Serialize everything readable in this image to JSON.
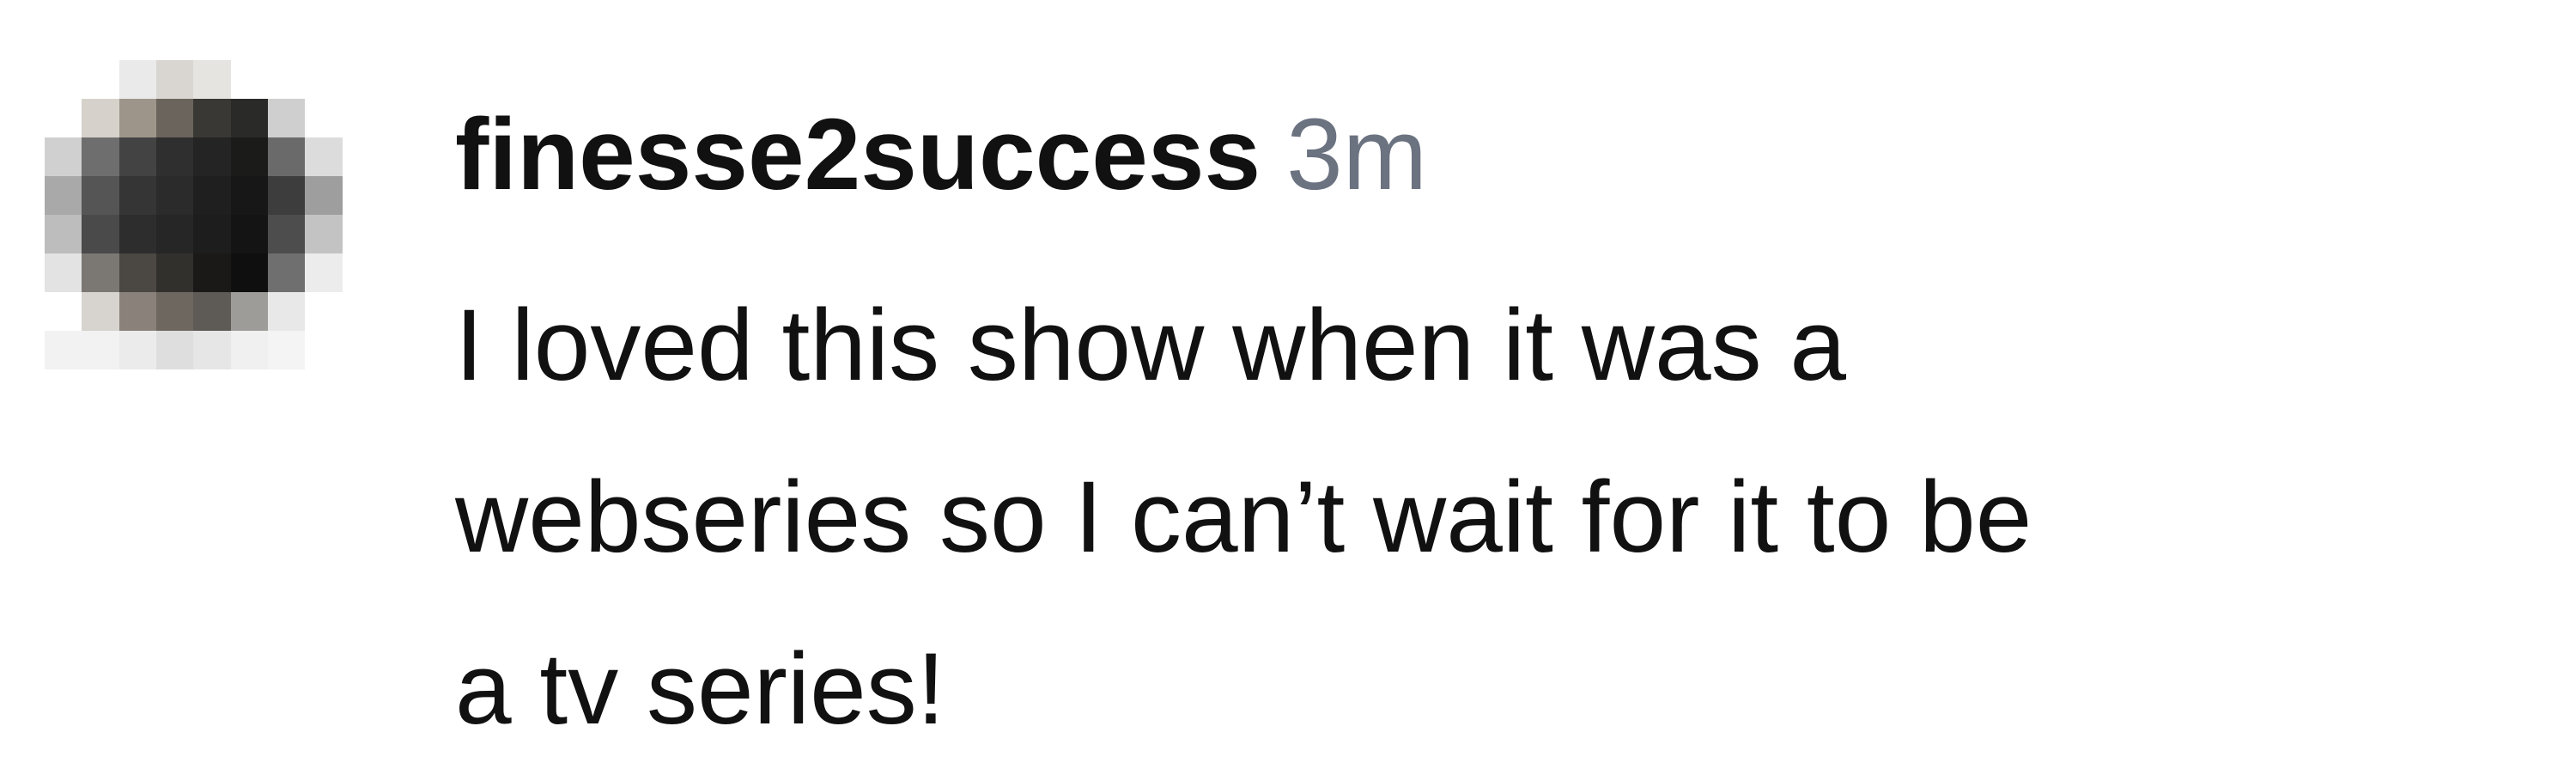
{
  "comment": {
    "username": "finesse2success",
    "timestamp": "3m",
    "text_lines": [
      "I loved this show when it was a",
      "webseries so I can’t wait for it to be",
      "a tv series!"
    ],
    "avatar": {
      "style": "pixelated",
      "colors": [
        "#ffffff",
        "#ffffff",
        "#eaeaea",
        "#d9d6d1",
        "#e6e4e1",
        "#ffffff",
        "#ffffff",
        "#ffffff",
        "#ffffff",
        "#ffffff",
        "#d6d2cb",
        "#9e958a",
        "#6a645c",
        "#3a3835",
        "#2a2a28",
        "#cfcfcf",
        "#ffffff",
        "#ffffff",
        "#d0d0d0",
        "#6e6e6e",
        "#434343",
        "#2f2f2f",
        "#242424",
        "#1b1b1a",
        "#6a6a6a",
        "#dcdcdc",
        "#ffffff",
        "#a9a9a9",
        "#555555",
        "#353535",
        "#2b2b2b",
        "#1f1f1f",
        "#171717",
        "#3d3d3d",
        "#9e9e9e",
        "#ffffff",
        "#bdbdbd",
        "#4a4a4a",
        "#2d2d2d",
        "#262626",
        "#1d1d1d",
        "#141414",
        "#4d4d4d",
        "#c3c3c3",
        "#ffffff",
        "#e3e3e3",
        "#7b7874",
        "#4b4742",
        "#32302d",
        "#1a1918",
        "#0f0f0f",
        "#6f6f6f",
        "#ececec",
        "#ffffff",
        "#ffffff",
        "#d7d4cf",
        "#8a827a",
        "#6e6760",
        "#5e5a55",
        "#9e9c99",
        "#e8e8e8",
        "#ffffff",
        "#ffffff",
        "#f2f2f2",
        "#f2f2f2",
        "#ebebeb",
        "#dedede",
        "#e6e6e6",
        "#f0f0f0",
        "#f4f4f4",
        "#ffffff",
        "#ffffff",
        "#ffffff",
        "#ffffff",
        "#ffffff",
        "#ffffff",
        "#ffffff",
        "#ffffff",
        "#ffffff",
        "#ffffff",
        "#ffffff"
      ]
    }
  }
}
